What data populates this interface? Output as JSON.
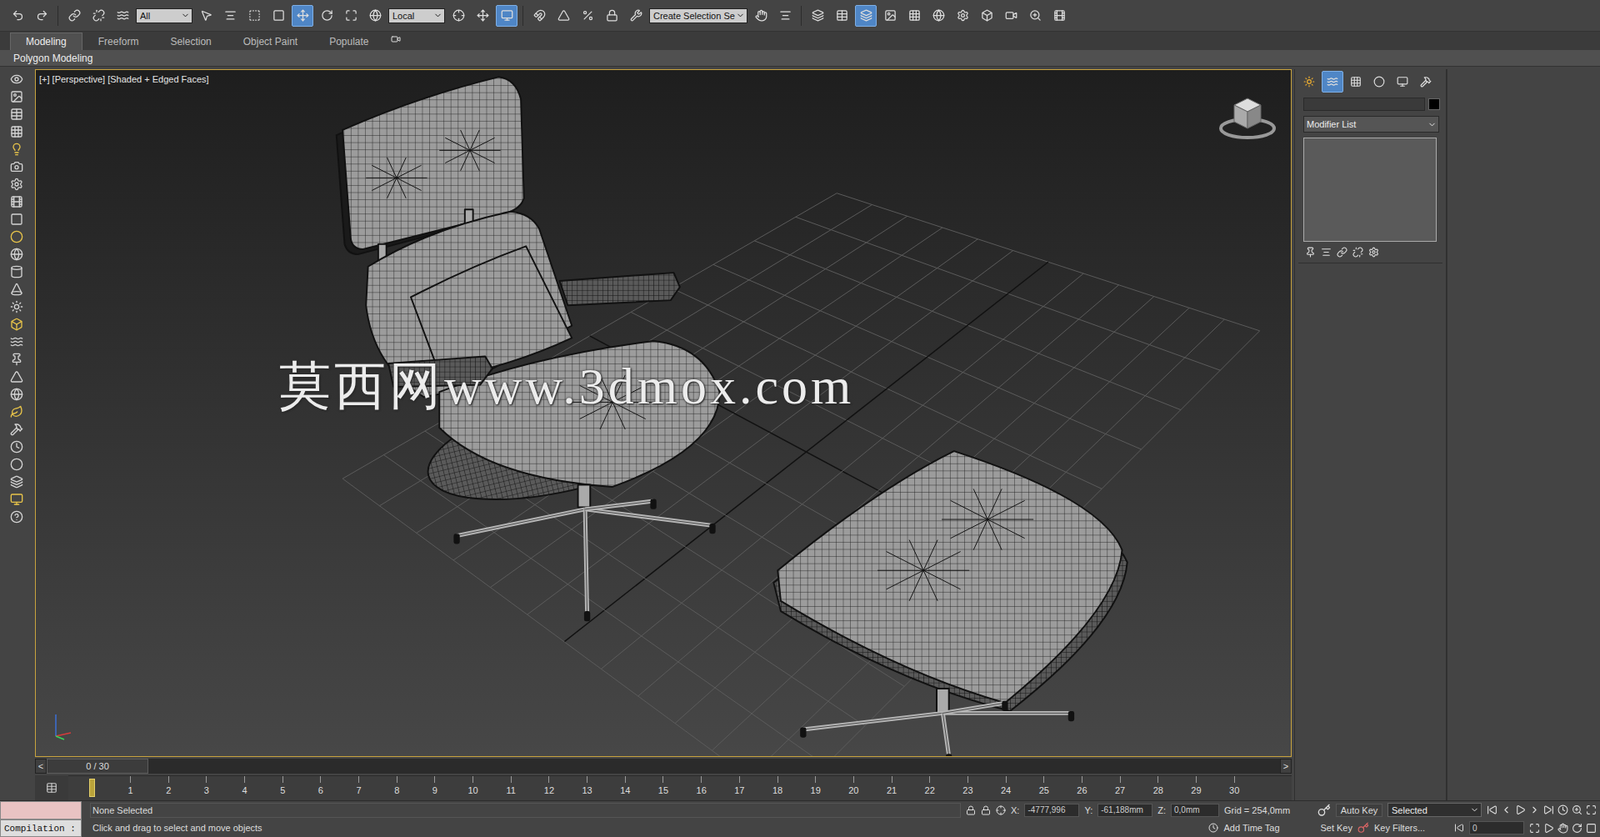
{
  "toolbar": {
    "selection_filter": "All",
    "reference_coordinate": "Local",
    "named_selection": "Create Selection Se"
  },
  "ribbon": {
    "tabs": [
      {
        "label": "Modeling",
        "selected": true
      },
      {
        "label": "Freeform",
        "selected": false
      },
      {
        "label": "Selection",
        "selected": false
      },
      {
        "label": "Object Paint",
        "selected": false
      },
      {
        "label": "Populate",
        "selected": false
      }
    ],
    "panel_label": "Polygon Modeling"
  },
  "viewport": {
    "label": "[+] [Perspective] [Shaded + Edged Faces]",
    "active": true,
    "watermark": "莫西网www.3dmox.com"
  },
  "command_panel": {
    "modifier_list": "Modifier List"
  },
  "time_slider": {
    "prev": "<",
    "label": "0 / 30",
    "next": ">",
    "level": 0
  },
  "trackbar": {
    "ticks": [
      "1",
      "2",
      "3",
      "4",
      "5",
      "6",
      "7",
      "8",
      "9",
      "10",
      "11",
      "12",
      "13",
      "14",
      "15",
      "16",
      "17",
      "18",
      "19",
      "20",
      "21",
      "22",
      "23",
      "24",
      "25",
      "26",
      "27",
      "28",
      "29",
      "30"
    ]
  },
  "status_bar": {
    "listener": "Compilation :",
    "prompt": "None Selected",
    "hint": "Click and drag to select and move objects",
    "x_label": "X:",
    "x": "-4777,996",
    "y_label": "Y:",
    "y": "-61,188mm",
    "z_label": "Z:",
    "z": "0,0mm",
    "grid": "Grid = 254,0mm",
    "add_time_tag": "Add Time Tag",
    "auto_key": "Auto Key",
    "key_mode": "Selected",
    "set_key": "Set Key",
    "key_filters": "Key Filters...",
    "frame": "0"
  }
}
